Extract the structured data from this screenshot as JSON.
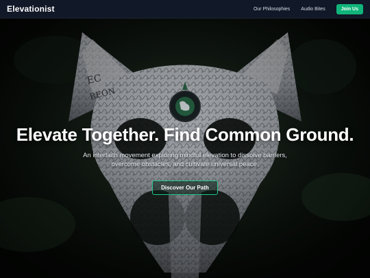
{
  "header": {
    "brand": "Elevationist",
    "nav": [
      {
        "label": "Our Philosophies"
      },
      {
        "label": "Audio Bites"
      }
    ],
    "join_label": "Join Us"
  },
  "hero": {
    "title": "Elevate Together. Find Common Ground.",
    "subtitle": "An interfaith movement exploring mindful elevation to dissolve barriers, overcome obstacles, and cultivate universal peace.",
    "cta_label": "Discover Our Path",
    "background_image": "ornate-white-carved-fox-skull-mask-in-forest"
  },
  "colors": {
    "navbar_bg": "#111827",
    "accent": "#10b47a",
    "cta_border": "#1ec98a",
    "text": "#ffffff"
  }
}
